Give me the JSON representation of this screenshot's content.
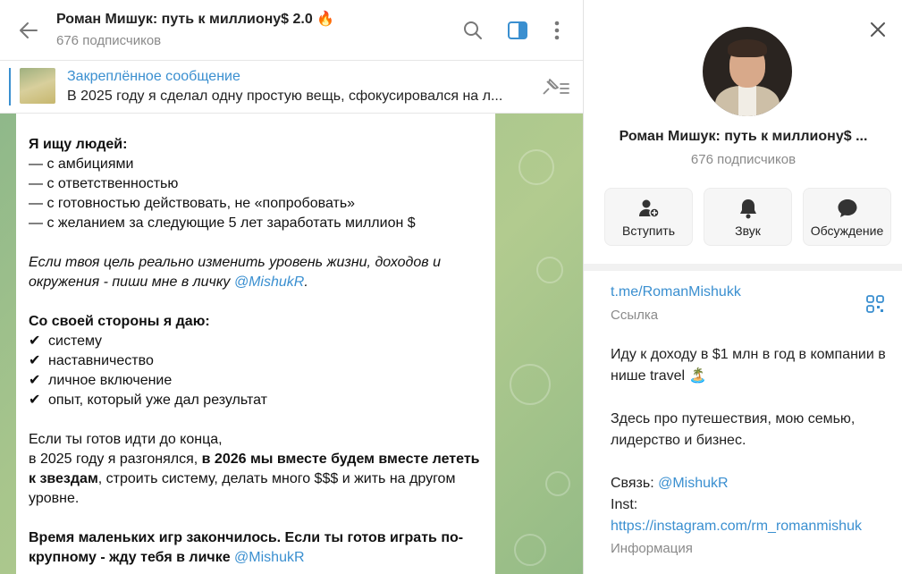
{
  "header": {
    "title": "Роман Мишук: путь к миллиону$ 2.0 🔥",
    "subscribers": "676 подписчиков"
  },
  "pinned": {
    "title": "Закреплённое сообщение",
    "text": "В 2025 году я сделал одну простую вещь, сфокусировался на л..."
  },
  "message": {
    "looking_heading": "Я ищу людей:",
    "looking_items": [
      "— с амбициями",
      "— с ответственностью",
      "— с готовностью действовать, не «попробовать»",
      "— с желанием за следующие 5 лет заработать миллион $"
    ],
    "goal_text": "Если твоя цель реально изменить уровень жизни, доходов и окружения - пиши мне в личку ",
    "goal_link": "@MishukR",
    "goal_end": ".",
    "give_heading": "Со своей стороны я даю:",
    "check_symbol": "✔",
    "give_items": [
      "системy",
      "наставничество",
      "личное включение",
      "опыт, который уже дал результат"
    ],
    "ready_line1": "Если ты готов идти до конца,",
    "ready_line2_start": "в 2025 году я разгонялся, ",
    "ready_line2_bold": "в 2026 мы вместе будем вместе лететь к звездам",
    "ready_line2_end": ", строить систему, делать много $$$ и жить на другом уровне.",
    "final_bold": "Время маленьких игр закончилось. Если ты готов играть по-крупному - жду тебя в личке ",
    "final_link": "@MishukR"
  },
  "profile": {
    "title": "Роман Мишук: путь к миллиону$ ...",
    "subscribers": "676 подписчиков",
    "actions": {
      "join": "Вступить",
      "sound": "Звук",
      "discussion": "Обсуждение"
    },
    "link": "t.me/RomanMishukk",
    "link_caption": "Ссылка",
    "desc_line1": "Иду к доходу в $1 млн в год в компании в нише travel 🏝️",
    "desc_line2": "Здесь про путешествия, мою семью, лидерство и бизнес.",
    "contact_label": "Связь: ",
    "contact_link": "@MishukR",
    "inst_label": "Inst:",
    "inst_link": "https://instagram.com/rm_romanmishuk",
    "info_caption": "Информация"
  }
}
